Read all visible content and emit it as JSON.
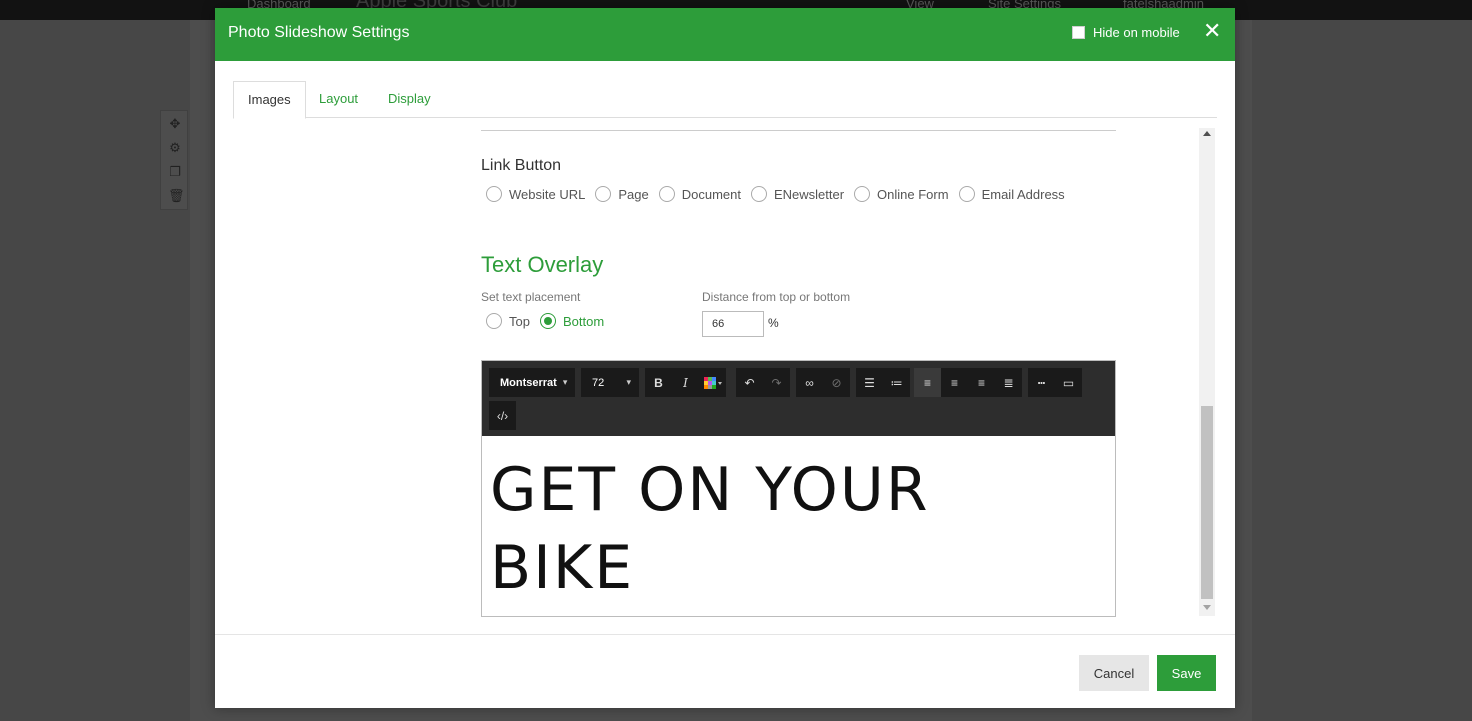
{
  "background": {
    "topbar": {
      "dashboard_label": "Dashboard",
      "site_name": "Apple Sports Club",
      "view_label": "View",
      "site_settings_label": "Site Settings",
      "user_label": "fatelshaadmin"
    }
  },
  "modal": {
    "title": "Photo Slideshow Settings",
    "hide_on_mobile_label": "Hide on mobile",
    "close_label": "✕",
    "tabs": [
      {
        "label": "Images",
        "active": true
      },
      {
        "label": "Layout",
        "active": false
      },
      {
        "label": "Display",
        "active": false
      }
    ],
    "link_button": {
      "label": "Link Button",
      "options": [
        "Website URL",
        "Page",
        "Document",
        "ENewsletter",
        "Online Form",
        "Email Address"
      ]
    },
    "text_overlay": {
      "title": "Text Overlay",
      "placement_label": "Set text placement",
      "placement_options": [
        "Top",
        "Bottom"
      ],
      "placement_selected": "Bottom",
      "distance_label": "Distance from top or bottom",
      "distance_value": "66",
      "distance_unit": "%"
    },
    "editor": {
      "font_family": "Montserrat",
      "font_size": "72",
      "content_line1": "GET ON YOUR",
      "content_line2": "BIKE"
    },
    "footer": {
      "cancel_label": "Cancel",
      "save_label": "Save"
    }
  },
  "colors": {
    "accent": "#2d9d3a",
    "header_bg": "#2d9d3a",
    "toolbar_bg": "#2d2d2d"
  }
}
